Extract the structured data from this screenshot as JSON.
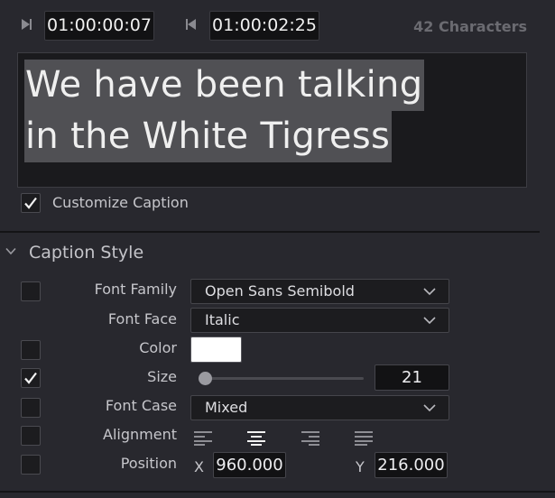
{
  "timecodes": {
    "in_icon": "mark-in-icon",
    "in_value": "01:00:00:07",
    "out_icon": "mark-out-icon",
    "out_value": "01:00:02:25",
    "char_count": "42 Characters"
  },
  "caption": {
    "line1": "We have been talking",
    "line2": "in the White Tigress"
  },
  "customize": {
    "label": "Customize Caption",
    "checked": true
  },
  "section": {
    "title": "Caption Style",
    "chevron_icon": "chevron-down-icon"
  },
  "fields": {
    "font_family_label": "Font Family",
    "font_family_value": "Open Sans Semibold",
    "font_face_label": "Font Face",
    "font_face_value": "Italic",
    "color_label": "Color",
    "color_value": "#ffffff",
    "size_label": "Size",
    "size_value": "21",
    "font_case_label": "Font Case",
    "font_case_value": "Mixed",
    "alignment_label": "Alignment",
    "alignment_selected": "center",
    "position_label": "Position",
    "x_label": "X",
    "x_value": "960.000",
    "y_label": "Y",
    "y_value": "216.000"
  },
  "checkboxes": {
    "font_family": false,
    "color": false,
    "size": true,
    "font_case": false,
    "alignment": false,
    "position": false
  },
  "colors": {
    "background": "#28282e",
    "field_bg": "#1c1c1f",
    "highlight": "#505054"
  }
}
